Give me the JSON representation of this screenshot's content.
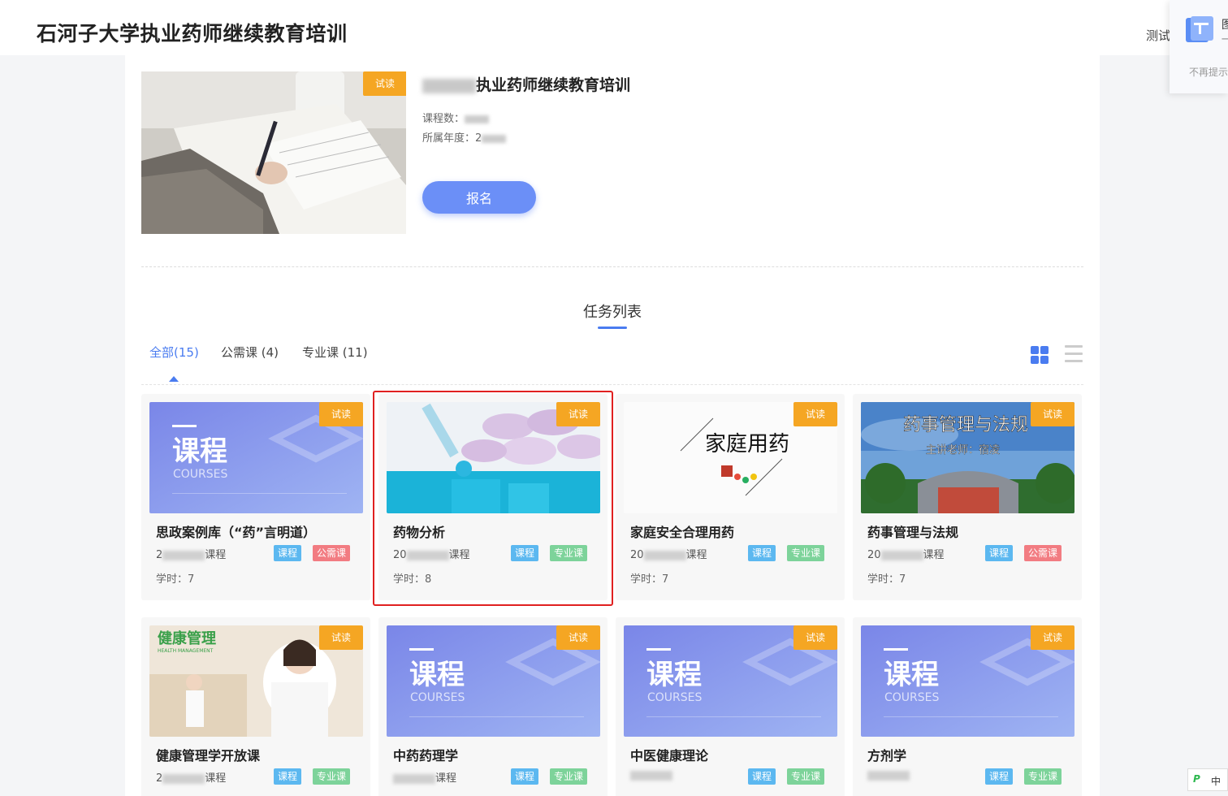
{
  "header": {
    "site_title": "石河子大学执业药师继续教育培训",
    "user_text": "测试"
  },
  "notice": {
    "title": "图",
    "subtitle": "一",
    "dismiss": "不再提示"
  },
  "course_info": {
    "trial_tag": "试读",
    "title_visible": "执业药师继续教育培训",
    "course_count_label": "课程数：",
    "year_label": "所属年度：",
    "year_value_partial": "2",
    "enroll_button": "报名"
  },
  "tasks": {
    "section_title": "任务列表",
    "tabs": [
      {
        "label": "全部(15)",
        "active": true
      },
      {
        "label": "公需课 (4)",
        "active": false
      },
      {
        "label": "专业课 (11)",
        "active": false
      }
    ],
    "hours_label": "学时：",
    "cards": [
      {
        "title": "思政案例库（“药”言明道）",
        "year_prefix": "2",
        "year_suffix": "课程",
        "tags": [
          "课程",
          "公需课"
        ],
        "hours": "7",
        "image": "course-placeholder"
      },
      {
        "title": "药物分析",
        "year_prefix": "20",
        "year_suffix": "课程",
        "tags": [
          "课程",
          "专业课"
        ],
        "hours": "8",
        "image": "pills-lab"
      },
      {
        "title": "家庭安全合理用药",
        "year_prefix": "20",
        "year_suffix": "课程",
        "tags": [
          "课程",
          "专业课"
        ],
        "hours": "7",
        "image": "family-medicine"
      },
      {
        "title": "药事管理与法规",
        "year_prefix": "20",
        "year_suffix": "课程",
        "tags": [
          "课程",
          "公需课"
        ],
        "hours": "7",
        "image": "university-gate",
        "img_title": "药事管理与法规",
        "img_sub": "主讲老师：宿凌"
      },
      {
        "title": "健康管理学开放课",
        "year_prefix": "2",
        "year_suffix": "课程",
        "tags": [
          "课程",
          "专业课"
        ],
        "hours": "",
        "image": "health-management",
        "img_title": "健康管理",
        "img_sub": "HEALTH MANAGEMENT"
      },
      {
        "title": "中药药理学",
        "year_prefix": "",
        "year_suffix": "课程",
        "tags": [
          "课程",
          "专业课"
        ],
        "hours": "",
        "image": "course-placeholder"
      },
      {
        "title": "中医健康理论",
        "year_prefix": "",
        "year_suffix": "",
        "tags": [
          "课程",
          "专业课"
        ],
        "hours": "",
        "image": "course-placeholder"
      },
      {
        "title": "方剂学",
        "year_prefix": "",
        "year_suffix": "",
        "tags": [
          "课程",
          "专业课"
        ],
        "hours": "",
        "image": "course-placeholder"
      }
    ],
    "placeholder_image": {
      "text_cn": "课程",
      "text_en": "COURSES"
    },
    "family_image": {
      "title": "家庭用药"
    }
  },
  "ime": {
    "label": "中"
  },
  "colors": {
    "accent": "#4a7cf0",
    "trial": "#f5a623",
    "course_tag": "#5cb8f0",
    "major_tag": "#7dd39a",
    "public_tag": "#f27c82"
  }
}
